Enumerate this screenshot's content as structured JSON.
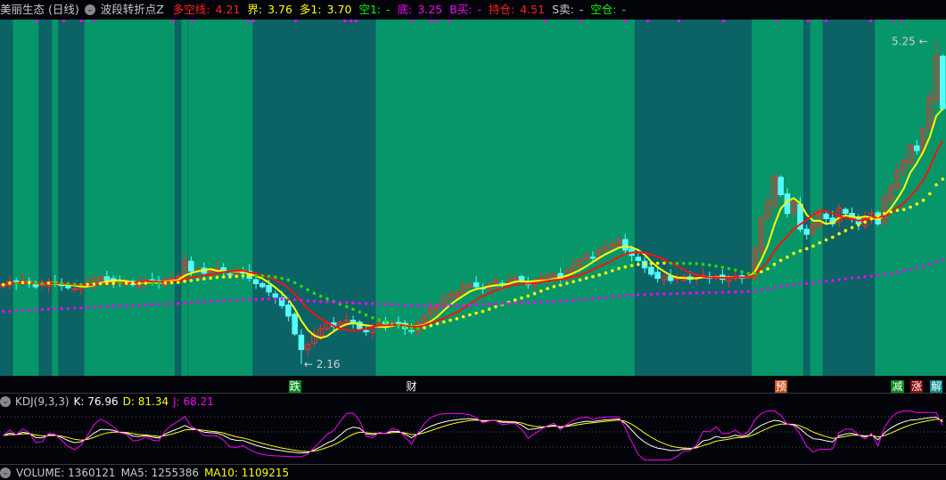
{
  "header": {
    "stock": "美丽生态 (日线)",
    "indicator": "波段转折点Z",
    "items": [
      {
        "label": "多空线:",
        "value": "4.21",
        "color": "#ff2020"
      },
      {
        "label": "界:",
        "value": "3.76",
        "color": "#ffff00"
      },
      {
        "label": "多1:",
        "value": "3.70",
        "color": "#ffff00"
      },
      {
        "label": "空1:",
        "value": "-",
        "color": "#00ff00"
      },
      {
        "label": "底:",
        "value": "3.25",
        "color": "#ff00ff"
      },
      {
        "label": "B买:",
        "value": "-",
        "color": "#ff00ff"
      },
      {
        "label": "持仓:",
        "value": "4.51",
        "color": "#ff2020"
      },
      {
        "label": "S卖:",
        "value": "-",
        "color": "#c8c8c8"
      },
      {
        "label": "空仓:",
        "value": "-",
        "color": "#00ff00"
      }
    ]
  },
  "annotations": {
    "high": "5.25",
    "low": "2.16"
  },
  "markers": [
    {
      "text": "跌",
      "bar": 45,
      "bg": "#0a8a1a"
    },
    {
      "text": "财",
      "bar": 63,
      "bg": "transparent"
    },
    {
      "text": "预",
      "bar": 120,
      "bg": "#c8501a"
    },
    {
      "text": "减",
      "bar": 138,
      "bg": "#0a8a1a"
    },
    {
      "text": "涨",
      "bar": 141,
      "bg": "#8a0a0a"
    },
    {
      "text": "解",
      "bar": 144,
      "bg": "#0a8a8a"
    }
  ],
  "kdj": {
    "title": "KDJ(9,3,3)",
    "k": "K: 76.96",
    "d": "D: 81.34",
    "j": "J: 68.21"
  },
  "volume": {
    "title": "VOLUME: 1360121",
    "ma5": "MA5: 1255386",
    "ma10": "MA10: 1109215"
  },
  "colors": {
    "band_dark": "#0b6366",
    "band_bright": "#079669",
    "up": "#ff2a2a",
    "down": "#54ffff"
  },
  "chart_data": {
    "type": "candlestick",
    "price_range": [
      2.05,
      5.45
    ],
    "closes": [
      2.92,
      2.95,
      2.93,
      2.96,
      2.94,
      2.9,
      2.92,
      2.95,
      2.93,
      2.91,
      2.89,
      2.88,
      2.9,
      2.93,
      2.97,
      2.99,
      2.96,
      2.95,
      2.93,
      2.94,
      2.92,
      2.95,
      2.96,
      2.94,
      2.93,
      2.97,
      2.98,
      3.0,
      3.15,
      3.05,
      3.06,
      3.03,
      3.05,
      3.07,
      3.04,
      3.02,
      3.05,
      3.03,
      2.98,
      2.93,
      2.9,
      2.85,
      2.8,
      2.72,
      2.62,
      2.45,
      2.3,
      2.35,
      2.45,
      2.5,
      2.55,
      2.52,
      2.56,
      2.58,
      2.55,
      2.5,
      2.47,
      2.52,
      2.55,
      2.53,
      2.56,
      2.54,
      2.5,
      2.48,
      2.55,
      2.62,
      2.7,
      2.72,
      2.78,
      2.82,
      2.85,
      2.9,
      2.92,
      2.9,
      2.88,
      2.92,
      2.95,
      2.93,
      2.96,
      2.98,
      2.95,
      2.92,
      2.96,
      2.98,
      3.0,
      3.02,
      2.98,
      3.05,
      3.1,
      3.15,
      3.2,
      3.18,
      3.25,
      3.28,
      3.3,
      3.35,
      3.25,
      3.2,
      3.15,
      3.08,
      3.02,
      2.98,
      3.0,
      2.96,
      2.98,
      3.0,
      2.97,
      2.99,
      3.01,
      2.98,
      3.0,
      2.97,
      2.99,
      3.0,
      2.98,
      3.0,
      3.25,
      3.55,
      3.7,
      3.95,
      3.78,
      3.6,
      3.7,
      3.45,
      3.4,
      3.5,
      3.6,
      3.55,
      3.5,
      3.65,
      3.6,
      3.55,
      3.5,
      3.55,
      3.6,
      3.5,
      3.75,
      3.85,
      4.0,
      4.1,
      4.25,
      4.2,
      4.4,
      4.7,
      5.1,
      4.6
    ],
    "low_bar": 46,
    "low_value": 2.16,
    "high_bar": 144,
    "high_value": 5.25,
    "bands": [
      [
        "dark",
        0,
        2
      ],
      [
        "bright",
        2,
        6
      ],
      [
        "dark",
        6,
        8
      ],
      [
        "bright",
        8,
        9
      ],
      [
        "dark",
        9,
        13
      ],
      [
        "bright",
        13,
        27
      ],
      [
        "dark",
        27,
        28
      ],
      [
        "bright",
        28,
        29
      ],
      [
        "dark",
        29,
        29
      ],
      [
        "bright",
        29,
        39
      ],
      [
        "dark",
        39,
        58
      ],
      [
        "bright",
        58,
        98
      ],
      [
        "dark",
        98,
        116
      ],
      [
        "bright",
        116,
        124
      ],
      [
        "dark",
        124,
        125
      ],
      [
        "bright",
        125,
        127
      ],
      [
        "dark",
        127,
        135
      ],
      [
        "bright",
        135,
        146
      ]
    ],
    "series": [
      "MA5 (yellow)",
      "MA10 (red)",
      "MA20 dotted (green falling / yellow rising)",
      "long MA dotted (magenta)"
    ]
  }
}
